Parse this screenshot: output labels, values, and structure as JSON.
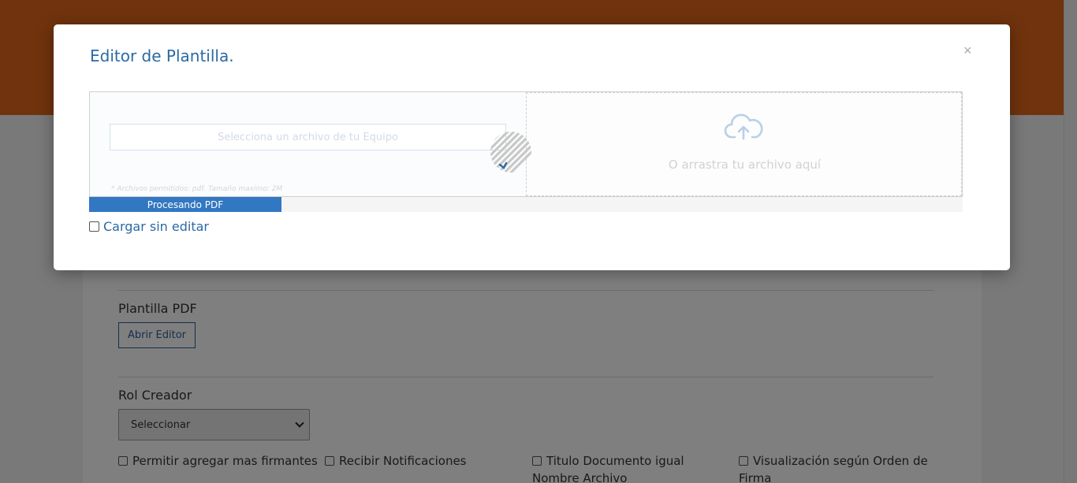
{
  "background": {
    "sections": {
      "template_pdf_label": "Plantilla PDF",
      "open_editor_button": "Abrir Editor",
      "creator_role_label": "Rol Creador",
      "creator_role_selected": "Seleccionar"
    },
    "options": [
      {
        "label": "Permitir agregar mas firmantes",
        "checked": false
      },
      {
        "label": "Recibir Notificaciones",
        "checked": false
      },
      {
        "label": "Titulo Documento igual Nombre Archivo",
        "checked": false
      },
      {
        "label": "Visualización según Orden de Firma",
        "checked": false
      }
    ],
    "colors": {
      "header": "#e0661a"
    }
  },
  "modal": {
    "title": "Editor de Plantilla.",
    "close_label": "×",
    "upload": {
      "file_button": "Selecciona un archivo de tu Equipo",
      "hint": "* Archivos permitidos: pdf. Tamaño maximo: 2M",
      "drop_text": "O arrastra tu archivo aquí",
      "cloud_icon": "cloud-upload-icon"
    },
    "progress": {
      "label": "Procesando PDF",
      "fraction": 0.22
    },
    "load_without_edit": {
      "label": "Cargar sin editar",
      "checked": false
    }
  }
}
